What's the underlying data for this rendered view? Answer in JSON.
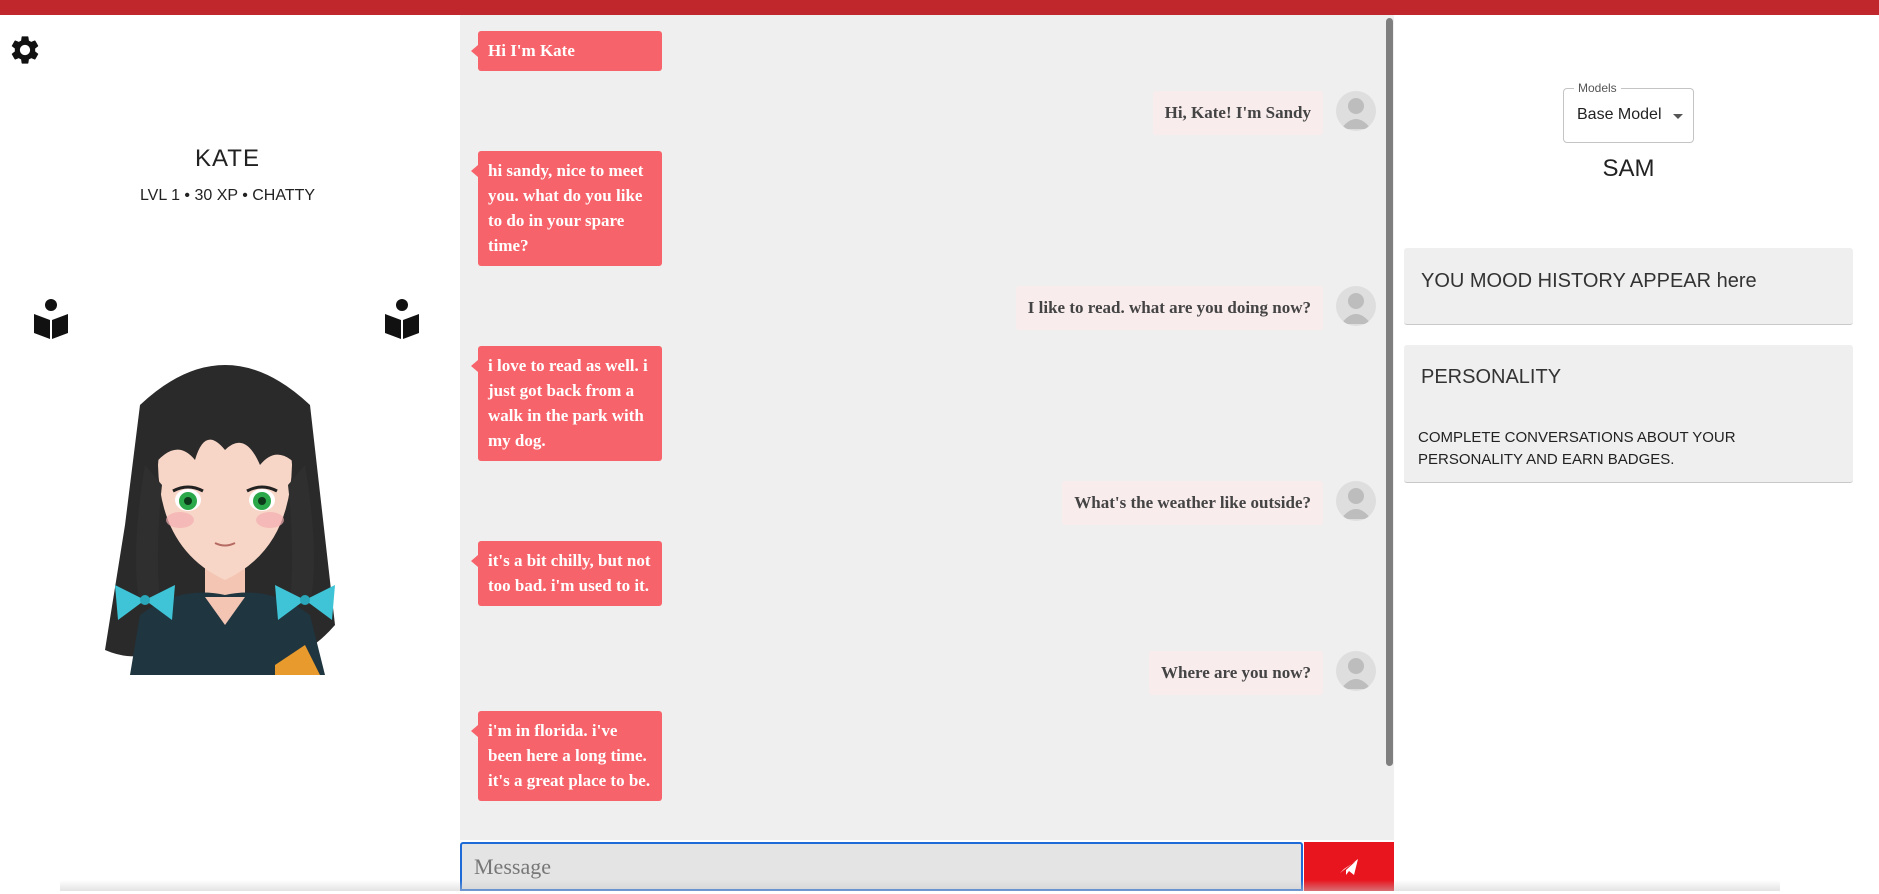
{
  "character": {
    "name": "KATE",
    "stats": "LVL 1 • 30 XP • CHATTY"
  },
  "chat": {
    "messages": [
      {
        "from": "bot",
        "text": "Hi I'm Kate"
      },
      {
        "from": "user",
        "text": "Hi, Kate! I'm Sandy"
      },
      {
        "from": "bot",
        "text": "hi sandy, nice to meet you. what do you like to do in your spare time?"
      },
      {
        "from": "user",
        "text": "I like to read. what are you doing now?"
      },
      {
        "from": "bot",
        "text": "i love to read as well. i just got back from a walk in the park with my dog."
      },
      {
        "from": "user",
        "text": "What's the weather like outside?"
      },
      {
        "from": "bot",
        "text": "it's a bit chilly, but not too bad. i'm used to it."
      },
      {
        "from": "user",
        "text": "Where are you now?"
      },
      {
        "from": "bot",
        "text": "i'm in florida. i've been here a long time. it's a great place to be."
      }
    ],
    "input_placeholder": "Message"
  },
  "models": {
    "label": "Models",
    "selected": "Base Model"
  },
  "user_name": "SAM",
  "mood": {
    "text": "YOU MOOD HISTORY APPEAR here"
  },
  "personality": {
    "title": "PERSONALITY",
    "description": "COMPLETE CONVERSATIONS ABOUT YOUR PERSONALITY AND EARN BADGES."
  },
  "icons": {
    "settings": "gear-icon",
    "books": "book-reader-icon",
    "send": "send-icon",
    "user_avatar": "person-icon",
    "dropdown": "caret-down-icon"
  },
  "colors": {
    "topbar": "#c0272d",
    "bot_bubble": "#f7636a",
    "user_bubble": "#f9eced",
    "send_button": "#e8151f",
    "input_focus": "#1e6ad6"
  }
}
